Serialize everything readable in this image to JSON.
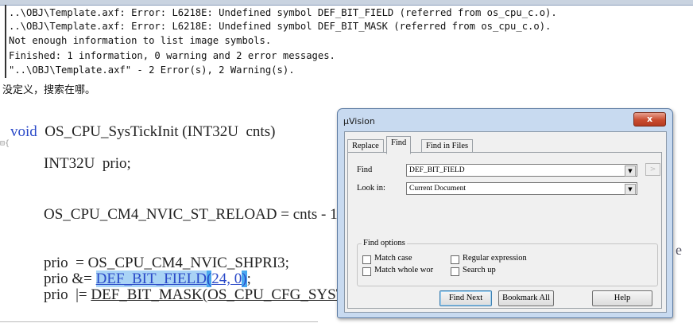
{
  "build_output": {
    "lines": [
      "..\\OBJ\\Template.axf: Error: L6218E: Undefined symbol DEF_BIT_FIELD (referred from os_cpu_c.o).",
      "..\\OBJ\\Template.axf: Error: L6218E: Undefined symbol DEF_BIT_MASK (referred from os_cpu_c.o).",
      "Not enough information to list image symbols.",
      "Finished: 1 information, 0 warning and 2 error messages.",
      "\"..\\OBJ\\Template.axf\" - 2 Error(s), 2 Warning(s)."
    ]
  },
  "post_text": "没定义，搜索在哪。",
  "code": {
    "line1_kw": "void",
    "line1_rest": "  OS_CPU_SysTickInit (INT32U  cnts)",
    "fold_marker": "⊟{",
    "line2": "INT32U  prio;",
    "line3": "OS_CPU_CM4_NVIC_ST_RELOAD = cnts - 1",
    "line4": "prio  = OS_CPU_CM4_NVIC_SHPRI3;",
    "line5_prefix": "prio &= ",
    "line5_symbol": "DEF_BIT_FIELD",
    "line5_open": "(",
    "line5_args": "24, 0",
    "line5_close": ")",
    "line5_end": ";",
    "line6_prefix": "prio  |= ",
    "line6_rest": "DEF_BIT_MASK(OS_CPU_CFG_SYST",
    "fragment_e": "e"
  },
  "dialog": {
    "title": "µVision",
    "close_label": "x",
    "tabs": [
      "Replace",
      "Find",
      "Find in Files"
    ],
    "active_tab": "Find",
    "find_label": "Find",
    "find_value": "DEF_BIT_FIELD",
    "lookin_label": "Look in:",
    "lookin_value": "Current Document",
    "more_label": ">",
    "options_title": "Find options",
    "options": {
      "match_case": {
        "label": "Match case",
        "checked": false
      },
      "match_whole": {
        "label": "Match whole wor",
        "checked": false
      },
      "regex": {
        "label": "Regular expression",
        "checked": false
      },
      "search_up": {
        "label": "Search up",
        "checked": false
      }
    },
    "buttons": {
      "find_next": "Find Next",
      "bookmark_all": "Bookmark All",
      "help": "Help"
    }
  },
  "colors": {
    "keyword": "#2a49c8",
    "search_highlight": "#a9d3f5",
    "brace_highlight": "#4aa9ef",
    "dialog_frame": "#c8daf0",
    "close_button": "#c94c30"
  }
}
